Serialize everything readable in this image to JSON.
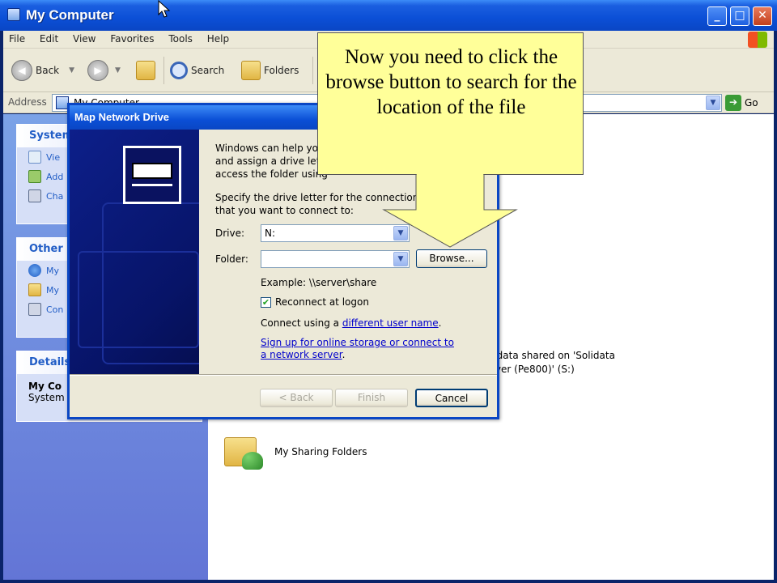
{
  "window": {
    "title": "My Computer",
    "buttons": {
      "minimize": "_",
      "maximize": "□",
      "close": "✕"
    }
  },
  "menu": [
    "File",
    "Edit",
    "View",
    "Favorites",
    "Tools",
    "Help"
  ],
  "toolbar": {
    "back": "Back",
    "search": "Search",
    "folders": "Folders"
  },
  "address": {
    "label": "Address",
    "value": "My Computer",
    "go": "Go"
  },
  "taskpane": {
    "system": {
      "header": "System",
      "items": [
        "Vie",
        "Add",
        "Cha"
      ]
    },
    "other": {
      "header": "Other P",
      "items": [
        "My",
        "My",
        "Con"
      ]
    },
    "details": {
      "header": "Details",
      "name": "My Co",
      "type": "System"
    }
  },
  "content": {
    "drive_line1": "lidata shared on 'Solidata",
    "drive_line2": "rver (Pe800)' (S:)",
    "sharing_folder": "My Sharing Folders"
  },
  "dialog": {
    "title": "Map Network Drive",
    "intro_line1": "Windows can help you",
    "intro_line2": "and assign a drive lett",
    "intro_line3": "access the folder using",
    "spec_line1": "Specify the drive letter for the connection a",
    "spec_line2": "that you want to connect to:",
    "drive_label": "Drive:",
    "drive_value": "N:",
    "folder_label": "Folder:",
    "folder_value": "",
    "browse": "Browse...",
    "example": "Example: \\\\server\\share",
    "reconnect": "Reconnect at logon",
    "reconnect_checked": true,
    "connect_prefix": "Connect using a ",
    "connect_link": "different user name",
    "connect_suffix": ".",
    "signup_link": "Sign up for online storage or connect to a network server",
    "signup_suffix": ".",
    "back": "< Back",
    "finish": "Finish",
    "cancel": "Cancel"
  },
  "callout": {
    "text": "Now you need to click the browse button to search for the location of the file"
  },
  "colors": {
    "titlebar": "#0b4fd6",
    "taskpane": "#6f8fdf",
    "callout": "#ffff99",
    "link": "#0000cc"
  }
}
